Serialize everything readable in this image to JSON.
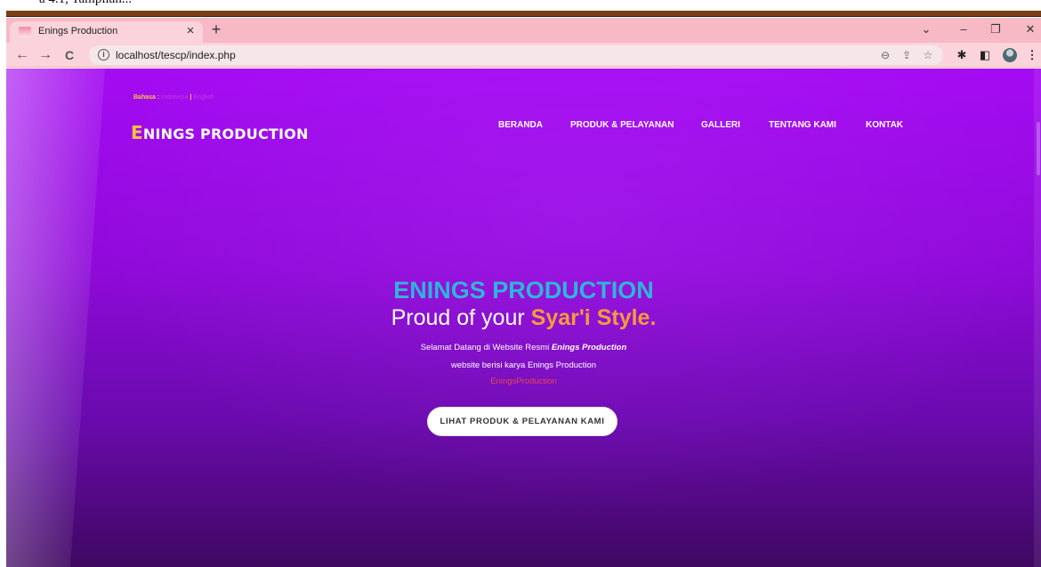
{
  "document": {
    "fragment_text": "a 4.1, Tampilan..."
  },
  "browser": {
    "tab": {
      "title": "Enings Production",
      "close_glyph": "×",
      "favicon": "enings-favicon-icon"
    },
    "new_tab_glyph": "+",
    "window_controls": {
      "tab_search": "⌄",
      "minimize": "–",
      "restore": "❐",
      "close": "✕"
    },
    "nav": {
      "back": "←",
      "forward": "→",
      "reload": "C"
    },
    "address": {
      "info_glyph": "i",
      "url": "localhost/tescp/index.php"
    },
    "omnibox_icons": {
      "zoom": "⊖",
      "share": "⇪",
      "bookmark": "☆"
    },
    "extensions": {
      "puzzle": "✱",
      "side_panel": "◧",
      "menu": "⋮"
    },
    "colors": {
      "tabbar": "#f7b9c5",
      "toolbar": "#fbd3da"
    }
  },
  "site": {
    "language": {
      "label": "Bahasa :",
      "options": [
        "Indonesia",
        "English"
      ],
      "separator": "|"
    },
    "brand": {
      "first_letter": "E",
      "rest": "NINGS PRODUCTION"
    },
    "menu": [
      "BERANDA",
      "PRODUK & PELAYANAN",
      "GALLERI",
      "TENTANG KAMI",
      "KONTAK"
    ],
    "hero": {
      "title": "ENINGS PRODUCTION",
      "tagline_prefix": "Proud of your ",
      "tagline_highlight": "Syar'i Style.",
      "welcome_prefix": "Selamat Datang di Website Resmi ",
      "welcome_emphasis": "Enings Production",
      "line2": "website berisi karya Enings Production",
      "line3": "EningsProduction",
      "cta": "LIHAT PRODUK & PELAYANAN KAMI"
    },
    "colors": {
      "accent_yellow": "#f7c240",
      "title_blue": "#2fb5d9",
      "highlight_orange": "#f79a3c",
      "bg_purple": "#a40bf2"
    }
  }
}
